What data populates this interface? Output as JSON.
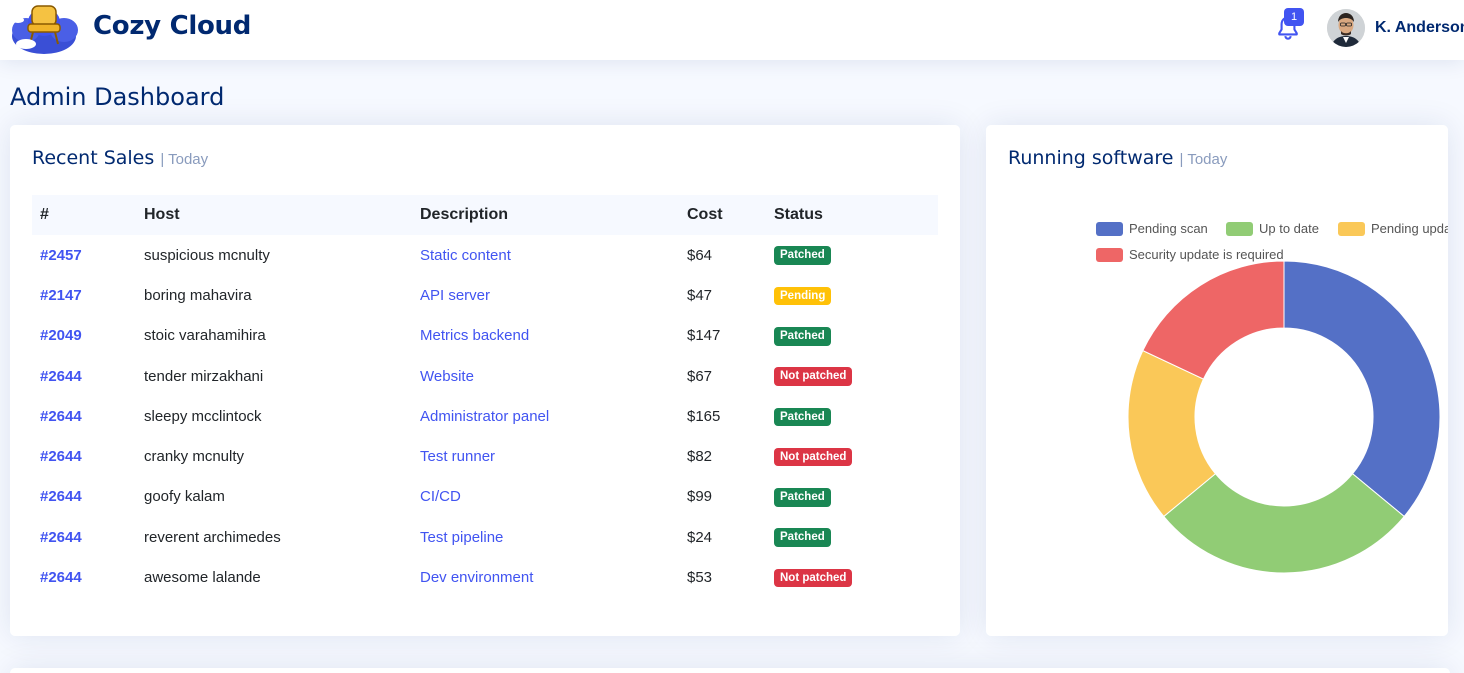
{
  "header": {
    "brand": "Cozy Cloud",
    "notification_count": "1",
    "user_name": "K. Anderson"
  },
  "page": {
    "title": "Admin Dashboard"
  },
  "sales": {
    "title": "Recent Sales",
    "subtitle": "| Today",
    "columns": [
      "#",
      "Host",
      "Description",
      "Cost",
      "Status"
    ],
    "rows": [
      {
        "id": "#2457",
        "host": "suspicious mcnulty",
        "description": "Static content",
        "cost": "$64",
        "status": "Patched"
      },
      {
        "id": "#2147",
        "host": "boring mahavira",
        "description": "API server",
        "cost": "$47",
        "status": "Pending"
      },
      {
        "id": "#2049",
        "host": "stoic varahamihira",
        "description": "Metrics backend",
        "cost": "$147",
        "status": "Patched"
      },
      {
        "id": "#2644",
        "host": "tender mirzakhani",
        "description": "Website",
        "cost": "$67",
        "status": "Not patched"
      },
      {
        "id": "#2644",
        "host": "sleepy mcclintock",
        "description": "Administrator panel",
        "cost": "$165",
        "status": "Patched"
      },
      {
        "id": "#2644",
        "host": "cranky mcnulty",
        "description": "Test runner",
        "cost": "$82",
        "status": "Not patched"
      },
      {
        "id": "#2644",
        "host": "goofy kalam",
        "description": "CI/CD",
        "cost": "$99",
        "status": "Patched"
      },
      {
        "id": "#2644",
        "host": "reverent archimedes",
        "description": "Test pipeline",
        "cost": "$24",
        "status": "Patched"
      },
      {
        "id": "#2644",
        "host": "awesome lalande",
        "description": "Dev environment",
        "cost": "$53",
        "status": "Not patched"
      }
    ]
  },
  "software": {
    "title": "Running software",
    "subtitle": "| Today"
  },
  "chart_data": {
    "type": "pie",
    "variant": "doughnut",
    "categories": [
      "Pending scan",
      "Up to date",
      "Pending update",
      "Security update is required"
    ],
    "values": [
      36,
      28,
      18,
      18
    ],
    "colors": [
      "#5470c6",
      "#91cc75",
      "#fac858",
      "#ee6666"
    ],
    "legend_position": "top"
  },
  "colors": {
    "brand": "#012970",
    "accent": "#4154f1",
    "patched": "#198754",
    "pending": "#ffc107",
    "not_patched": "#dc3545"
  },
  "icons": {
    "logo": "cloud-chair-logo",
    "notifications": "bell-icon",
    "avatar": "user-avatar"
  }
}
